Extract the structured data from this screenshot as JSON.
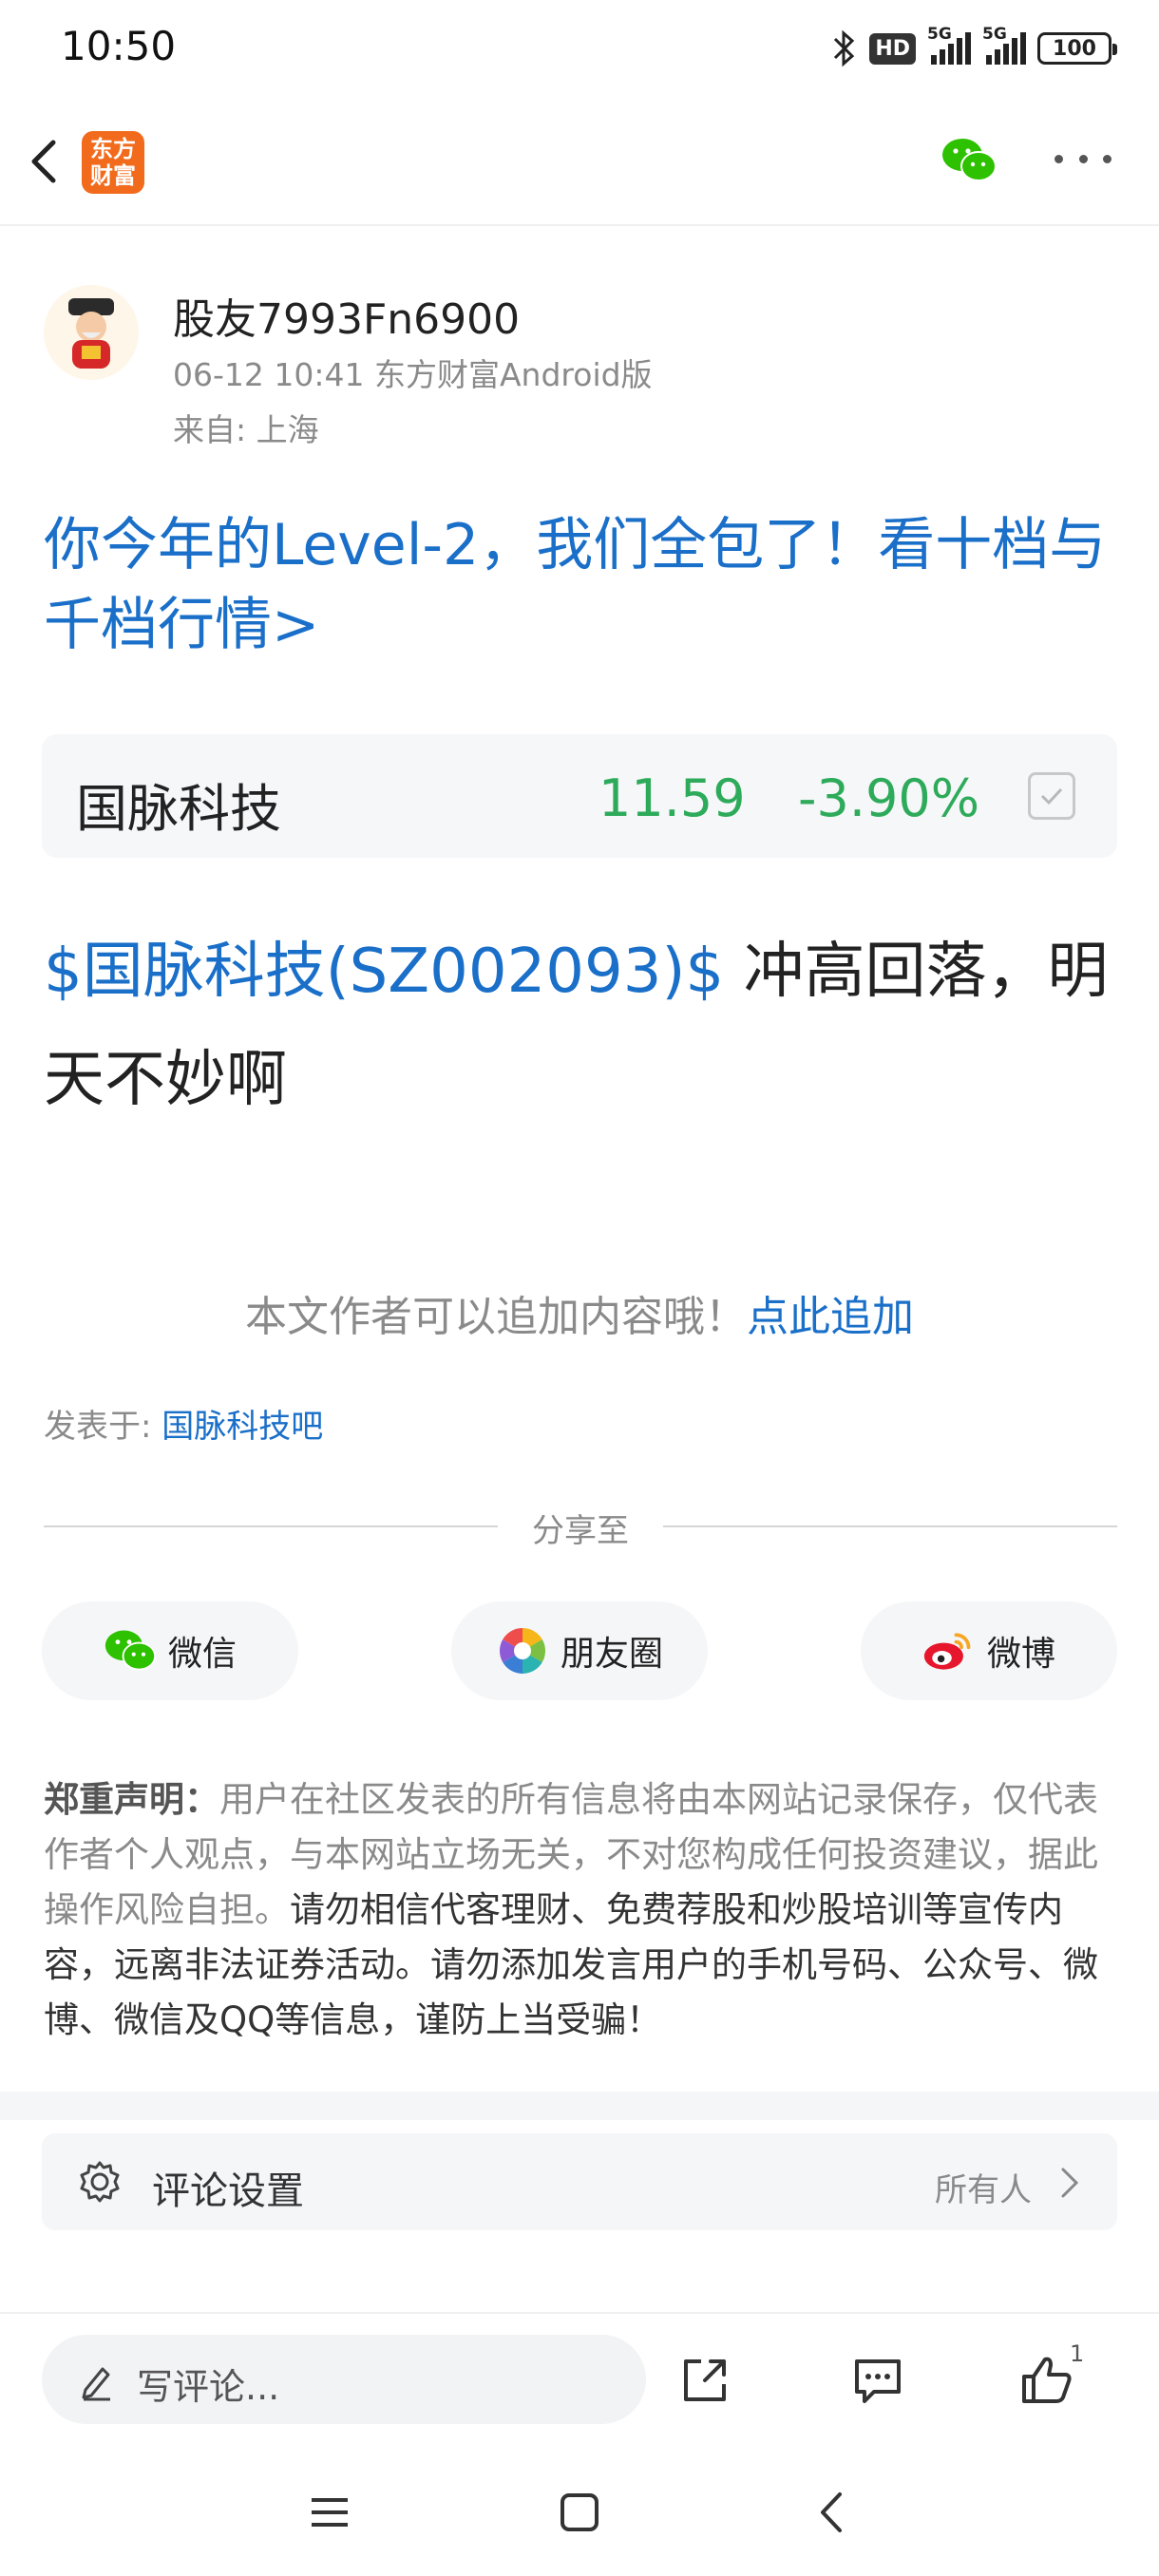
{
  "status_bar": {
    "time": "10:50",
    "hd": "HD",
    "sig1_label": "5G",
    "sig2_label": "5G",
    "battery": "100"
  },
  "header": {
    "logo_text": "东方\n财富"
  },
  "author": {
    "name": "股友7993Fn6900",
    "meta": "06-12 10:41 东方财富Android版",
    "from": "来自: 上海"
  },
  "ad_title": "你今年的Level-2，我们全包了！看十档与千档行情>",
  "stock": {
    "name": "国脉科技",
    "price": "11.59",
    "change": "-3.90%"
  },
  "post": {
    "stock_link": "$国脉科技(SZ002093)$",
    "text": " 冲高回落，明天不妙啊"
  },
  "append": {
    "tip": "本文作者可以追加内容哦！",
    "link": "点此追加"
  },
  "posted_in": {
    "label": "发表于: ",
    "bar": "国脉科技吧"
  },
  "share": {
    "label": "分享至",
    "wechat": "微信",
    "moments": "朋友圈",
    "weibo": "微博"
  },
  "disclaimer": {
    "lead": "郑重声明：",
    "normal": "用户在社区发表的所有信息将由本网站记录保存，仅代表作者个人观点，与本网站立场无关，不对您构成任何投资建议，据此操作风险自担。",
    "warn": "请勿相信代客理财、免费荐股和炒股培训等宣传内容，远离非法证券活动。请勿添加发言用户的手机号码、公众号、微博、微信及QQ等信息，谨防上当受骗！"
  },
  "comment_settings": {
    "label": "评论设置",
    "value": "所有人"
  },
  "bottom_bar": {
    "placeholder": "写评论...",
    "like_count": "1"
  },
  "colors": {
    "link_blue": "#1a6fc9",
    "down_green": "#2eab5a",
    "brand_orange": "#f26a1b"
  }
}
